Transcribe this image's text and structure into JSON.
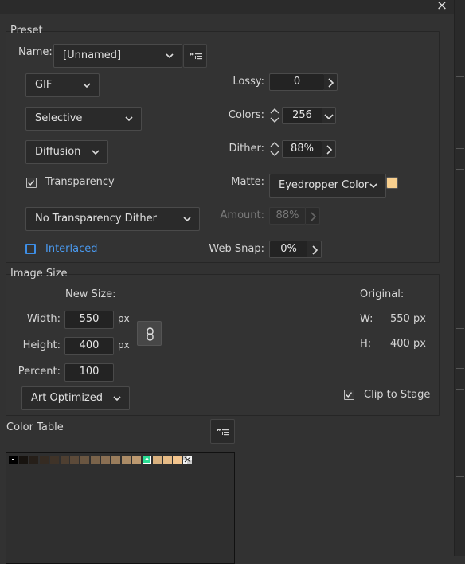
{
  "window": {
    "close_glyph": "×"
  },
  "preset": {
    "title": "Preset",
    "name_label": "Name:",
    "name_value": "[Unnamed]",
    "format_value": "GIF",
    "palette_value": "Selective",
    "dither_algo_value": "Diffusion",
    "transparency_label": "Transparency",
    "transparency_checked": true,
    "transparency_dither_value": "No Transparency Dither",
    "interlaced_label": "Interlaced",
    "interlaced_checked": false,
    "lossy_label": "Lossy:",
    "lossy_value": "0",
    "colors_label": "Colors:",
    "colors_value": "256",
    "dither_label": "Dither:",
    "dither_value": "88%",
    "matte_label": "Matte:",
    "matte_value": "Eyedropper Color",
    "matte_color": "#f8cf8e",
    "amount_label": "Amount:",
    "amount_value": "88%",
    "websnap_label": "Web Snap:",
    "websnap_value": "0%"
  },
  "image_size": {
    "title": "Image Size",
    "new_size_label": "New Size:",
    "width_label": "Width:",
    "width_value": "550",
    "height_label": "Height:",
    "height_value": "400",
    "px_unit": "px",
    "percent_label": "Percent:",
    "percent_value": "100",
    "quality_value": "Art Optimized",
    "original_label": "Original:",
    "orig_w_label": "W:",
    "orig_w_value": "550 px",
    "orig_h_label": "H:",
    "orig_h_value": "400 px",
    "clip_label": "Clip to Stage",
    "clip_checked": true
  },
  "color_table": {
    "title": "Color Table",
    "colors": [
      "#000000",
      "#17130f",
      "#261f19",
      "#352b22",
      "#3f3328",
      "#4e3f31",
      "#5c4a39",
      "#6a5641",
      "#7a634a",
      "#8a6f53",
      "#9a7d5c",
      "#ab8b66",
      "#bc9970",
      "#2bdc93",
      "#d8b07e",
      "#e6bb86",
      "#f3c58e",
      "#f5f5f5"
    ]
  },
  "icons": {
    "chevron": "chevron-down-icon",
    "step_right": "chevron-right-icon",
    "spinner": "spinner-up-down-icon",
    "menu": "options-menu-icon",
    "link": "link-icon",
    "check": "checkmark-icon",
    "close": "close-icon"
  }
}
